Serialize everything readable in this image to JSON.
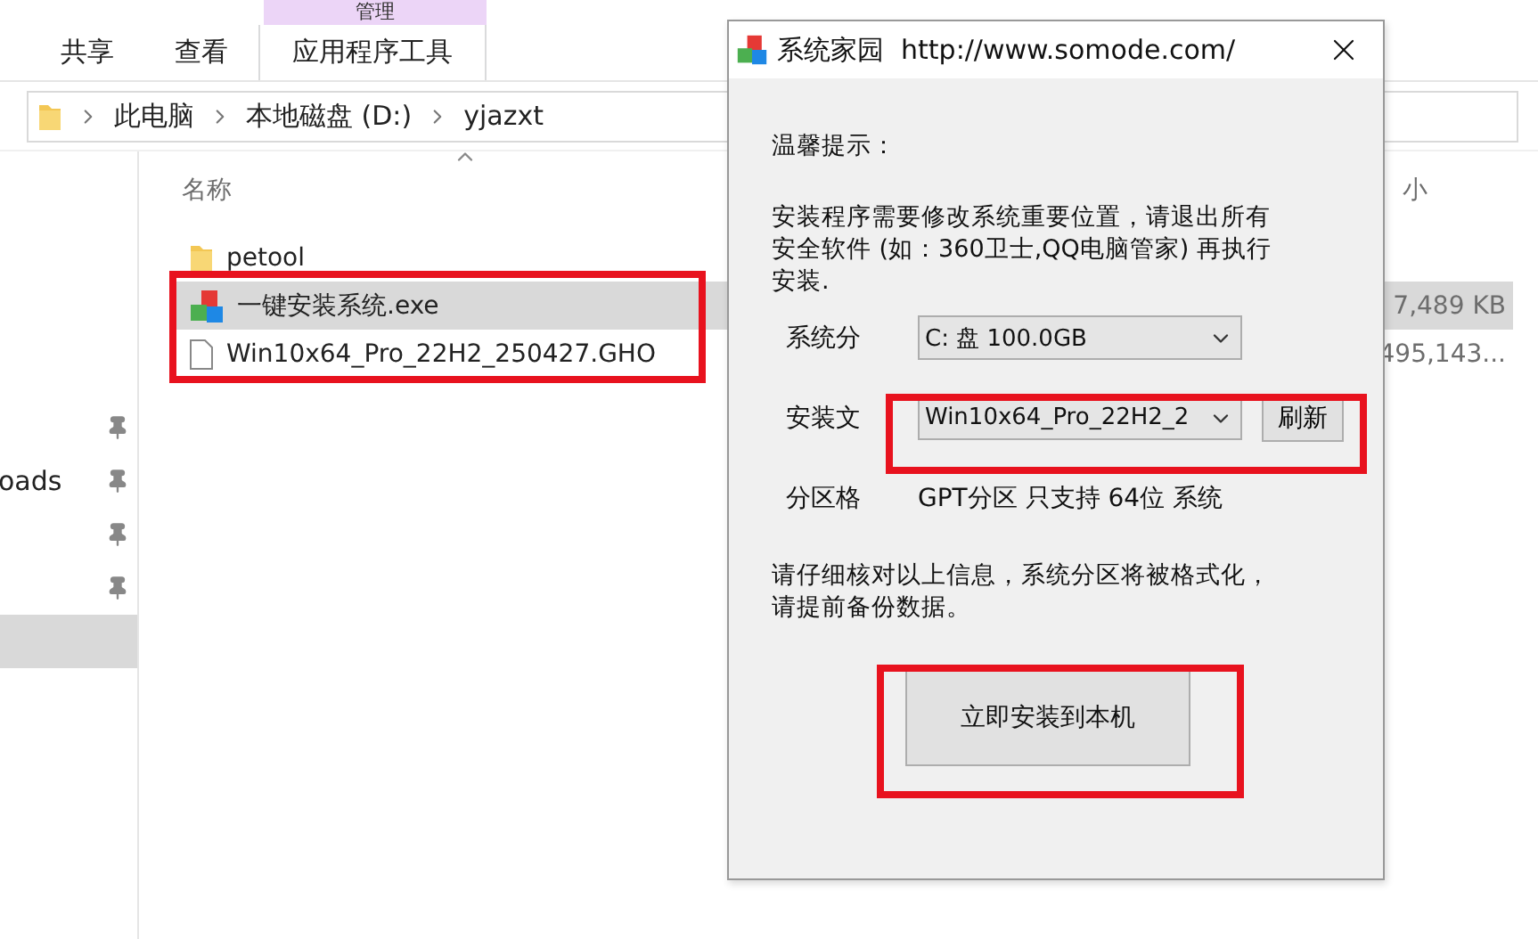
{
  "explorer": {
    "context_tab": "管理",
    "ribbon_tabs": [
      {
        "label": "共享",
        "selected": false
      },
      {
        "label": "查看",
        "selected": false
      },
      {
        "label": "应用程序工具",
        "selected": true
      }
    ],
    "breadcrumb": [
      "此电脑",
      "本地磁盘 (D:)",
      "yjazxt"
    ],
    "name_header": "名称",
    "size_header": "小",
    "nav_items": [
      {
        "pinned": true,
        "selected": false
      },
      {
        "label": "oads",
        "pinned": true,
        "selected": false
      },
      {
        "pinned": true,
        "selected": false
      },
      {
        "pinned": true,
        "selected": false
      },
      {
        "pinned": false,
        "selected": true
      }
    ],
    "files": [
      {
        "name": "petool",
        "kind": "folder",
        "selected": false
      },
      {
        "name": "一键安装系统.exe",
        "kind": "app",
        "selected": true,
        "size": "7,489 KB"
      },
      {
        "name": "Win10x64_Pro_22H2_250427.GHO",
        "kind": "file",
        "selected": false,
        "size": "495,143..."
      }
    ]
  },
  "dialog": {
    "title": "系统家园  http://www.somode.com/",
    "tip_heading": "温馨提示：",
    "notice_lines": [
      "安装程序需要修改系统重要位置，请退出所有",
      "安全软件 (如：360卫士,QQ电脑管家) 再执行",
      "安装."
    ],
    "fields": [
      {
        "label": "系统分",
        "kind": "combo",
        "value": "C: 盘 100.0GB"
      },
      {
        "label": "安装文",
        "kind": "combo",
        "value": "Win10x64_Pro_22H2_2",
        "button": "刷新"
      },
      {
        "label": "分区格",
        "kind": "text",
        "value": "GPT分区 只支持 64位 系统"
      }
    ],
    "warning_lines": [
      "请仔细核对以上信息，系统分区将被格式化，",
      "请提前备份数据。"
    ],
    "install_button": "立即安装到本机"
  }
}
